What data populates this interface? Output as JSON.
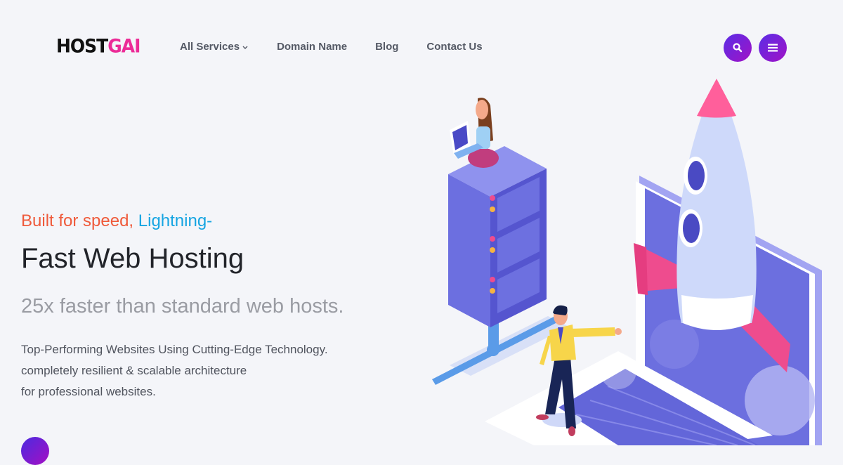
{
  "brand": {
    "logo_part1": "HOST",
    "logo_part2": "GAI",
    "accent_pink": "#ec2b97"
  },
  "nav": {
    "items": [
      {
        "label": "All Services",
        "has_dropdown": true
      },
      {
        "label": "Domain Name",
        "has_dropdown": false
      },
      {
        "label": "Blog",
        "has_dropdown": false
      },
      {
        "label": "Contact Us",
        "has_dropdown": false
      }
    ],
    "search_icon": "search-icon",
    "menu_icon": "hamburger-menu-icon",
    "button_gradient": [
      "#5a2de6",
      "#a112c6"
    ]
  },
  "hero": {
    "tagline_part1": "Built for speed,",
    "tagline_part2": "Lightning-",
    "tagline_color1": "#ef5a3b",
    "tagline_color2": "#16a5e2",
    "title": "Fast Web Hosting",
    "subtitle": "25x faster than standard web hosts.",
    "description": [
      "Top-Performing Websites Using Cutting-Edge Technology.",
      "completely resilient & scalable architecture",
      "for professional websites."
    ]
  },
  "illustration": {
    "description": "Isometric illustration: woman with laptop sitting on a server rack, man in yellow jacket pointing, rocket launching from a laptop screen"
  }
}
